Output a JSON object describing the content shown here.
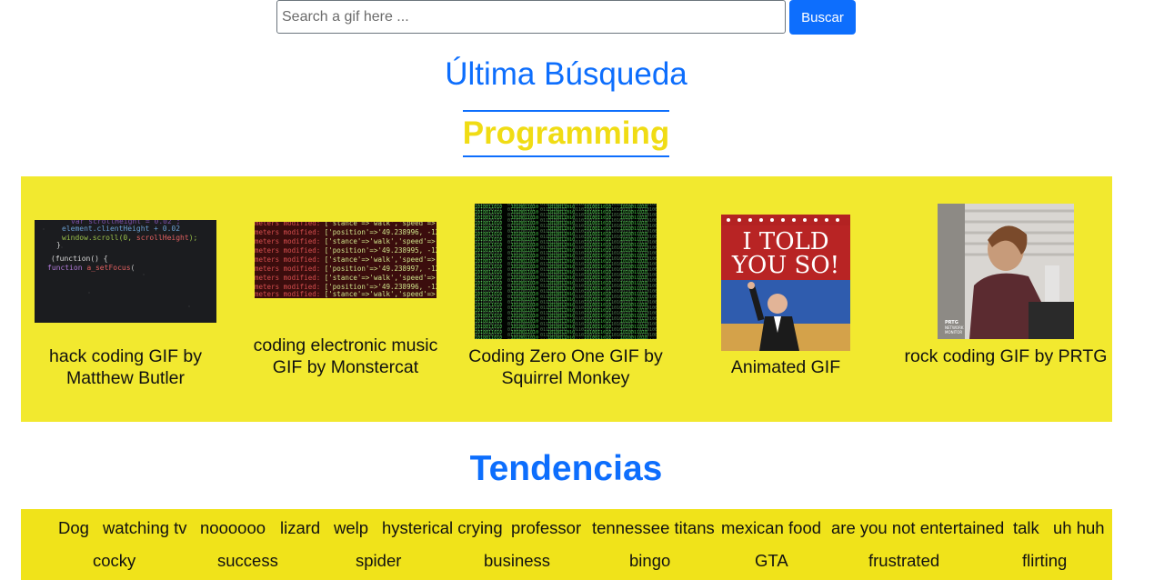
{
  "search": {
    "placeholder": "Search a gif here ...",
    "button_label": "Buscar"
  },
  "last_search": {
    "heading": "Última Búsqueda",
    "term": "Programming"
  },
  "results": [
    {
      "title": "hack coding GIF by Matthew Butler",
      "icon": "code-editor-image"
    },
    {
      "title": "coding electronic music GIF by Monstercat",
      "icon": "terminal-log-image"
    },
    {
      "title": "Coding Zero One GIF by Squirrel Monkey",
      "icon": "binary-matrix-image"
    },
    {
      "title": "Animated GIF",
      "icon": "i-told-you-so-image",
      "image_text": "I TOLD YOU SO!"
    },
    {
      "title": "rock coding GIF by PRTG",
      "icon": "office-worker-image",
      "image_text": "PRTG NETWORK MONITOR"
    }
  ],
  "trending": {
    "heading": "Tendencias",
    "row1": [
      "Dog",
      "watching tv",
      "noooooo",
      "lizard",
      "welp",
      "hysterical crying",
      "professor",
      "tennessee titans",
      "mexican food",
      "are you not entertained",
      "talk",
      "uh huh"
    ],
    "row2": [
      "cocky",
      "success",
      "spider",
      "business",
      "bingo",
      "GTA",
      "frustrated",
      "flirting"
    ]
  },
  "colors": {
    "accent": "#0d6efd",
    "panel_yellow": "#f2e92f",
    "term_yellow": "#f0dc14"
  }
}
